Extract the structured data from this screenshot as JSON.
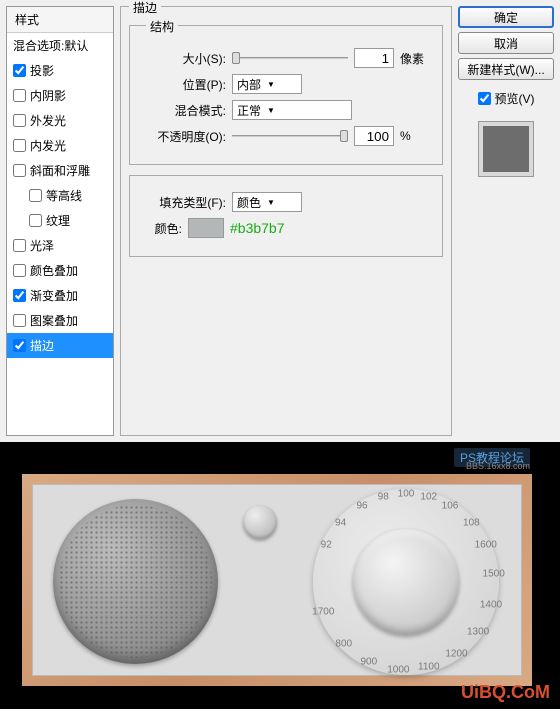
{
  "styles_panel": {
    "header": "样式",
    "blend_opts": "混合选项:默认",
    "items": [
      {
        "label": "投影",
        "checked": true
      },
      {
        "label": "内阴影",
        "checked": false
      },
      {
        "label": "外发光",
        "checked": false
      },
      {
        "label": "内发光",
        "checked": false
      },
      {
        "label": "斜面和浮雕",
        "checked": false
      },
      {
        "label": "等高线",
        "checked": false,
        "indent": true
      },
      {
        "label": "纹理",
        "checked": false,
        "indent": true
      },
      {
        "label": "光泽",
        "checked": false
      },
      {
        "label": "颜色叠加",
        "checked": false
      },
      {
        "label": "渐变叠加",
        "checked": true
      },
      {
        "label": "图案叠加",
        "checked": false
      },
      {
        "label": "描边",
        "checked": true,
        "selected": true
      }
    ]
  },
  "settings": {
    "group_title": "描边",
    "structure_title": "结构",
    "size_label": "大小(S):",
    "size_value": "1",
    "size_unit": "像素",
    "position_label": "位置(P):",
    "position_value": "内部",
    "blendmode_label": "混合模式:",
    "blendmode_value": "正常",
    "opacity_label": "不透明度(O):",
    "opacity_value": "100",
    "opacity_unit": "%",
    "filltype_label": "填充类型(F):",
    "filltype_value": "颜色",
    "color_label": "颜色:",
    "color_hex": "#b3b7b7"
  },
  "buttons": {
    "ok": "确定",
    "cancel": "取消",
    "new_style": "新建样式(W)...",
    "preview": "预览(V)"
  },
  "radio": {
    "freqs": [
      "92",
      "94",
      "96",
      "98",
      "100",
      "102",
      "106",
      "108",
      "1600",
      "1500",
      "1400",
      "1300",
      "1200",
      "1100",
      "1000",
      "900",
      "800",
      "1700"
    ]
  },
  "watermarks": {
    "top1": "PS教程论坛",
    "top2": "BBS.16xx8.com",
    "bottom": "UiBQ.CoM"
  }
}
